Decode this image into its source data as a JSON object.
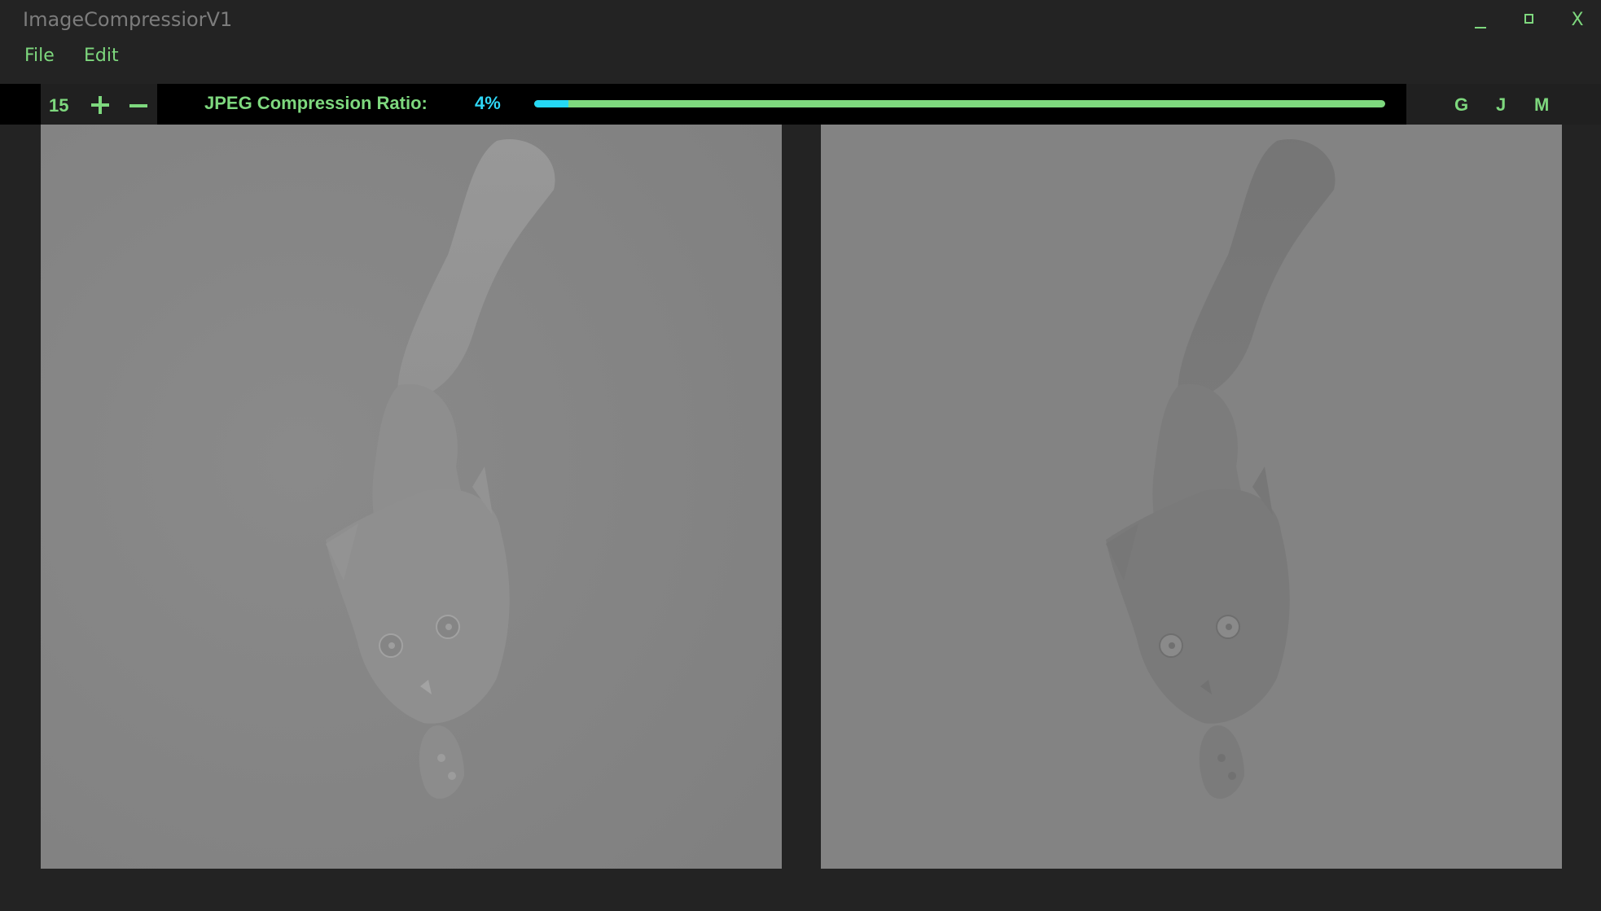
{
  "window": {
    "title": "ImageCompressiorV1",
    "controls": {
      "minimize": "_",
      "maximize": "□",
      "close": "X"
    }
  },
  "menu": {
    "file": "File",
    "edit": "Edit"
  },
  "toolbar": {
    "zoom_value": "15",
    "zoom_in_icon": "plus-icon",
    "zoom_out_icon": "minus-icon",
    "ratio_label": "JPEG Compression Ratio:",
    "ratio_value": "4%",
    "ratio_fraction": 0.04,
    "modes": [
      "G",
      "J",
      "M"
    ]
  },
  "panels": {
    "left": {
      "content": "grayscale cat photo (original)"
    },
    "right": {
      "content": "grayscale cat photo (compressed)"
    }
  },
  "colors": {
    "background": "#232323",
    "toolbar": "#000000",
    "accent_green": "#7ed87e",
    "accent_cyan": "#25d8f5",
    "title_gray": "#7c7c7c"
  }
}
